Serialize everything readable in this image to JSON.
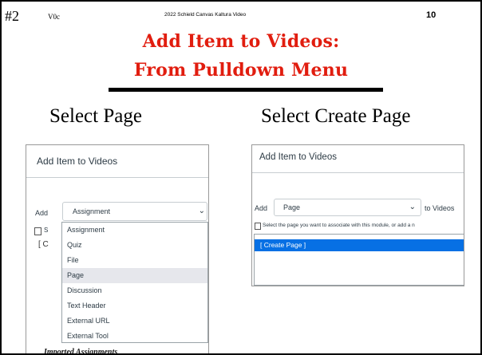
{
  "header": {
    "slide_number": "#2",
    "version": "V0c",
    "credit": "2022 Schield Canvas Kaltura Video",
    "page_number": "10"
  },
  "title": {
    "line1": "Add Item to Videos:",
    "line2": "From Pulldown Menu"
  },
  "subtitles": {
    "left": "Select Page",
    "right": "Select Create Page"
  },
  "colors": {
    "title_red": "#e11d0f",
    "highlight_blue": "#0770e4",
    "menu_selected_bg": "#e6e7ec"
  },
  "left_screenshot": {
    "dialog_title": "Add Item to Videos",
    "add_label": "Add",
    "selected_value": "Assignment",
    "chevron": "⌄",
    "doc_fragment": "S",
    "background_text": "[ C",
    "bottom_cutoff_text": "Imported Assignments",
    "dropdown_options": [
      "Assignment",
      "Quiz",
      "File",
      "Page",
      "Discussion",
      "Text Header",
      "External URL",
      "External Tool"
    ],
    "dropdown_highlighted": "Page"
  },
  "right_screenshot": {
    "dialog_title": "Add Item to Videos",
    "add_label": "Add",
    "selected_value": "Page",
    "chevron": "⌄",
    "to_label": "to Videos",
    "help_text": "Select the page you want to associate with this module, or add a n",
    "list_option": "[ Create Page ]"
  },
  "icons": {
    "page_doc": "document-icon",
    "dropdown": "chevron-down-icon"
  }
}
